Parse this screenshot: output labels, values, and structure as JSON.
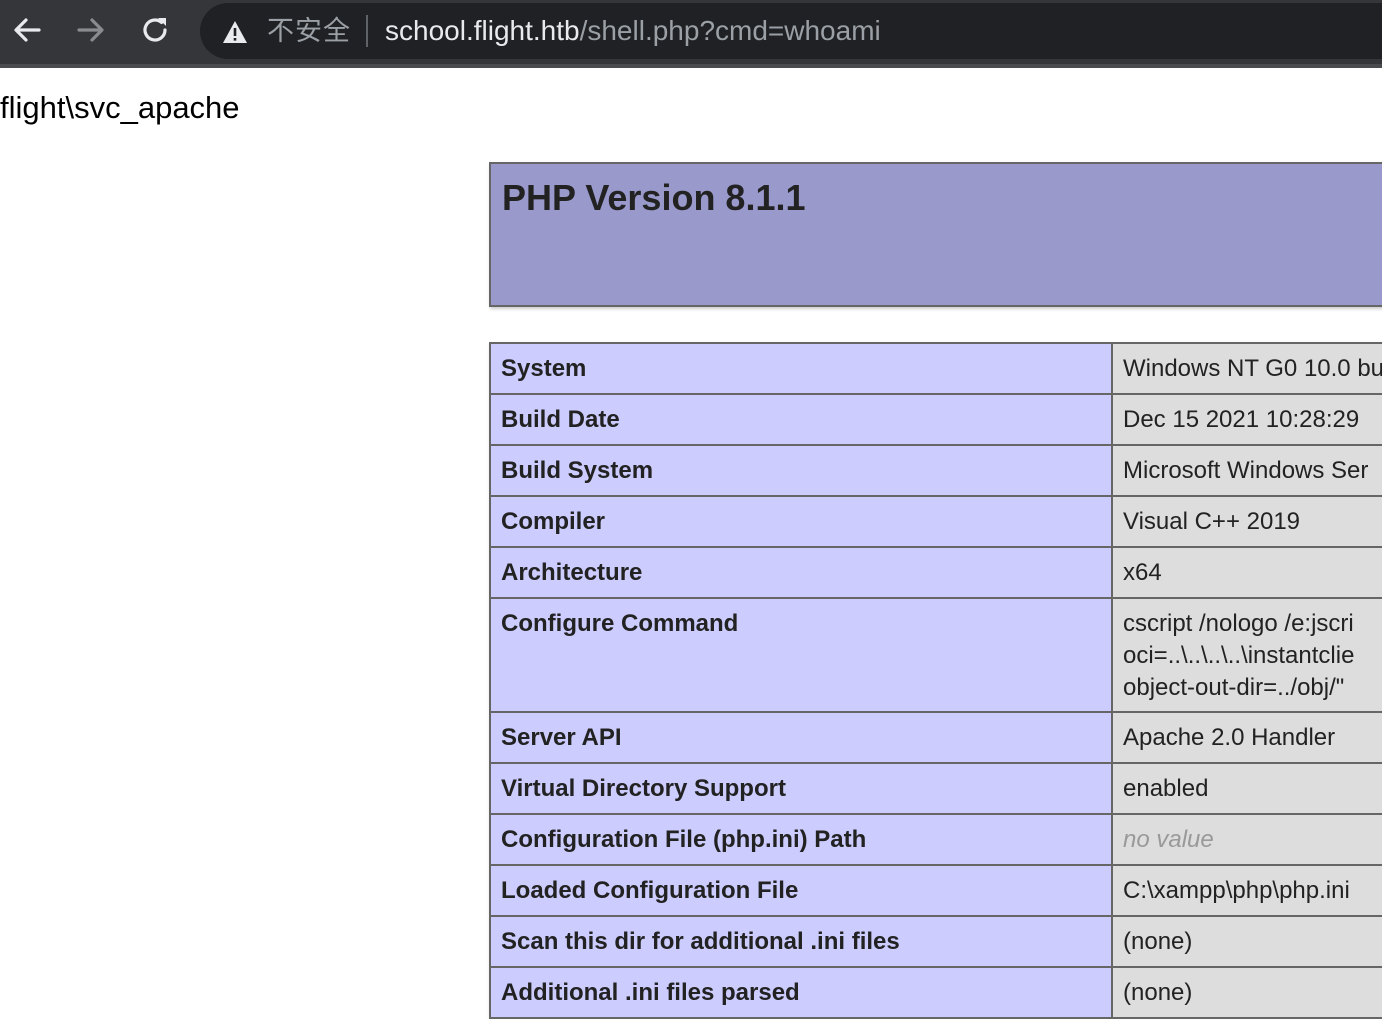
{
  "browser": {
    "security_label": "不安全",
    "url_host": "school.flight.htb",
    "url_path": "/shell.php?cmd=whoami",
    "icons": {
      "back": "arrow-left-icon",
      "forward": "arrow-right-icon",
      "reload": "reload-icon",
      "security": "warning-triangle-icon"
    }
  },
  "page": {
    "command_output": "flight\\svc_apache"
  },
  "phpinfo": {
    "title": "PHP Version 8.1.1",
    "rows": [
      {
        "key": "System",
        "value": "Windows NT G0 10.0 bu"
      },
      {
        "key": "Build Date",
        "value": "Dec 15 2021 10:28:29"
      },
      {
        "key": "Build System",
        "value": "Microsoft Windows Ser"
      },
      {
        "key": "Compiler",
        "value": "Visual C++ 2019"
      },
      {
        "key": "Architecture",
        "value": "x64"
      },
      {
        "key": "Configure Command",
        "value_lines": [
          "cscript /nologo /e:jscri",
          "oci=..\\..\\..\\..\\instantclie",
          "object-out-dir=../obj/\""
        ]
      },
      {
        "key": "Server API",
        "value": "Apache 2.0 Handler"
      },
      {
        "key": "Virtual Directory Support",
        "value": "enabled"
      },
      {
        "key": "Configuration File (php.ini) Path",
        "value": "no value"
      },
      {
        "key": "Loaded Configuration File",
        "value": "C:\\xampp\\php\\php.ini"
      },
      {
        "key": "Scan this dir for additional .ini files",
        "value": "(none)"
      },
      {
        "key": "Additional .ini files parsed",
        "value": "(none)"
      }
    ]
  },
  "colors": {
    "header_bg": "#9999cc",
    "key_bg": "#ccccff",
    "value_bg": "#dddddd",
    "browser_bg": "#35363a",
    "omnibox_bg": "#202124"
  }
}
